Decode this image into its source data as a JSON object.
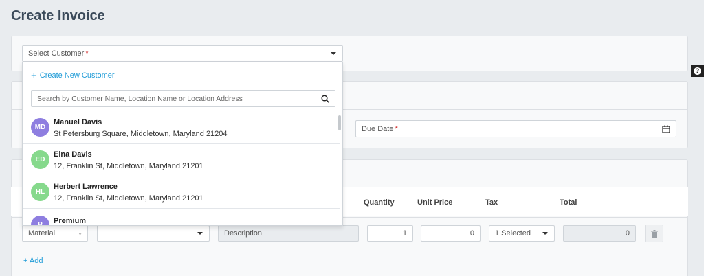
{
  "page_title": "Create Invoice",
  "customer_select": {
    "label": "Select Customer",
    "required": "*"
  },
  "dropdown": {
    "create_new": "Create New Customer",
    "search_placeholder": "Search by Customer Name, Location Name or Location Address",
    "customers": [
      {
        "initials": "MD",
        "name": "Manuel Davis",
        "address": "St Petersburg Square, Middletown, Maryland 21204",
        "color": "#8e7ee0"
      },
      {
        "initials": "ED",
        "name": "Elna Davis",
        "address": "12, Franklin St, Middletown, Maryland 21201",
        "color": "#86d98c"
      },
      {
        "initials": "HL",
        "name": "Herbert Lawrence",
        "address": "12, Franklin St, Middletown, Maryland 21201",
        "color": "#86d98c"
      },
      {
        "initials": "P",
        "name": "Premium",
        "address": "",
        "color": "#8e7ee0"
      }
    ]
  },
  "due_date": {
    "label": "Due Date",
    "required": "*"
  },
  "line_items": {
    "columns": {
      "quantity": "Quantity",
      "unit_price": "Unit Price",
      "tax": "Tax",
      "total": "Total"
    },
    "row": {
      "type": "Material",
      "description_placeholder": "Description",
      "quantity": "1",
      "unit_price": "0",
      "tax": "1 Selected",
      "total": "0"
    },
    "add_label": "+ Add"
  },
  "colors": {
    "accent": "#1e9bd7",
    "required": "#d32f2f"
  }
}
